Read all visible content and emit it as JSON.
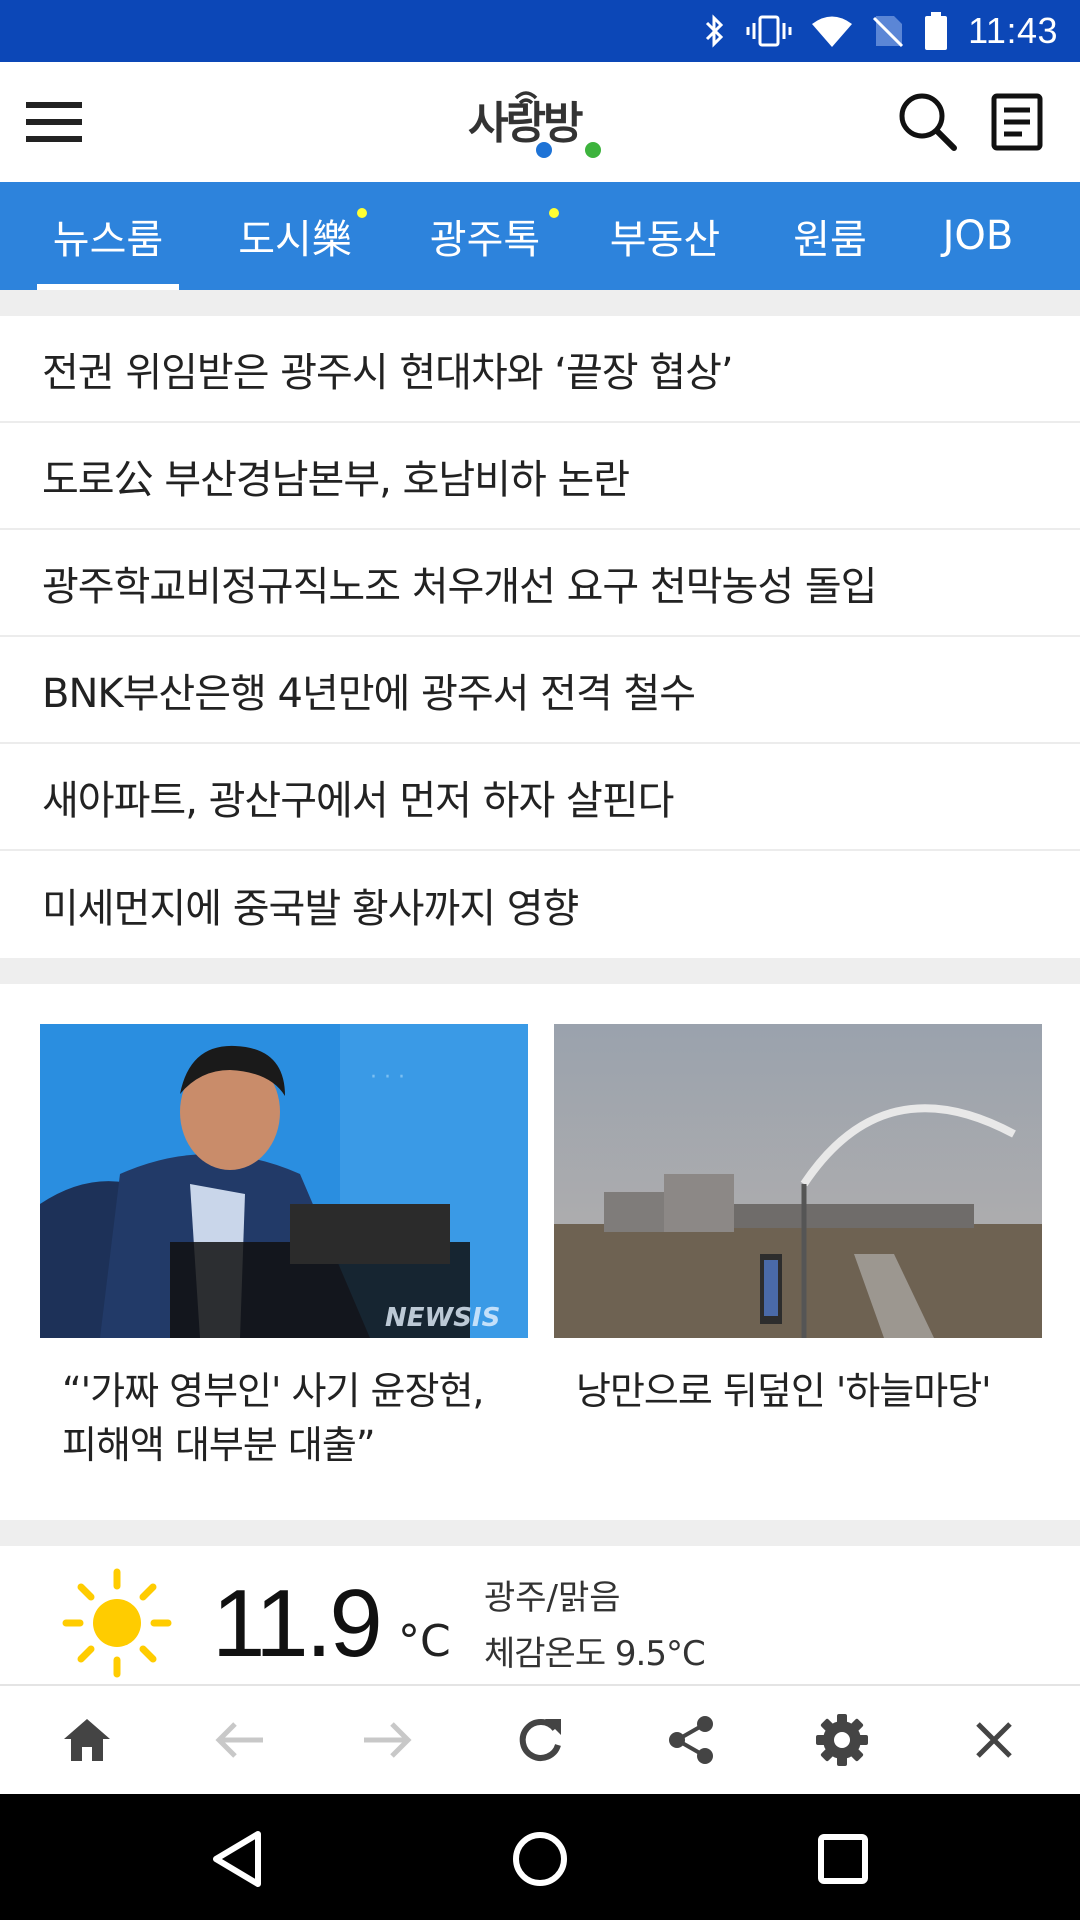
{
  "status_bar": {
    "time": "11:43",
    "icons": [
      "bluetooth-icon",
      "vibrate-icon",
      "wifi-icon",
      "no-sim-icon",
      "battery-icon"
    ]
  },
  "header": {
    "logo_text": "사랑방",
    "icons": [
      "menu-icon",
      "search-icon",
      "document-icon"
    ]
  },
  "tabs": [
    {
      "label": "뉴스룸",
      "active": true,
      "dot": false
    },
    {
      "label": "도시樂",
      "active": false,
      "dot": true
    },
    {
      "label": "광주톡",
      "active": false,
      "dot": true
    },
    {
      "label": "부동산",
      "active": false,
      "dot": false
    },
    {
      "label": "원룸",
      "active": false,
      "dot": false
    },
    {
      "label": "JOB",
      "active": false,
      "dot": false
    }
  ],
  "headlines": [
    "전권 위임받은 광주시 현대차와 ‘끝장 협상’",
    "도로公 부산경남본부, 호남비하 논란",
    "광주학교비정규직노조 처우개선 요구 천막농성 돌입",
    "BNK부산은행 4년만에 광주서 전격 철수",
    "새아파트, 광산구에서 먼저 하자 살핀다",
    "미세먼지에 중국발 황사까지 영향"
  ],
  "photo_cards": [
    {
      "caption": "“'가짜 영부인' 사기 윤장현, 피해액 대부분 대출”",
      "watermark": "NEWSIS"
    },
    {
      "caption": "낭만으로 뒤덮인 '하늘마당'",
      "watermark": ""
    }
  ],
  "weather": {
    "icon": "sun-icon",
    "temperature": "11.9",
    "unit": "°C",
    "location_condition": "광주/맑음",
    "feels_like": "체감온도 9.5°C"
  },
  "toolbar": {
    "icons": [
      "home-icon",
      "back-arrow-icon",
      "forward-arrow-icon",
      "refresh-icon",
      "share-icon",
      "settings-icon",
      "close-icon"
    ]
  },
  "colors": {
    "status_bar": "#0c47b7",
    "tab_bar": "#2d83dc",
    "tab_dot": "#ffff33",
    "sun": "#ffcc00",
    "logo_dark": "#333333",
    "logo_blue": "#1e73d6",
    "logo_green": "#3db33d"
  }
}
